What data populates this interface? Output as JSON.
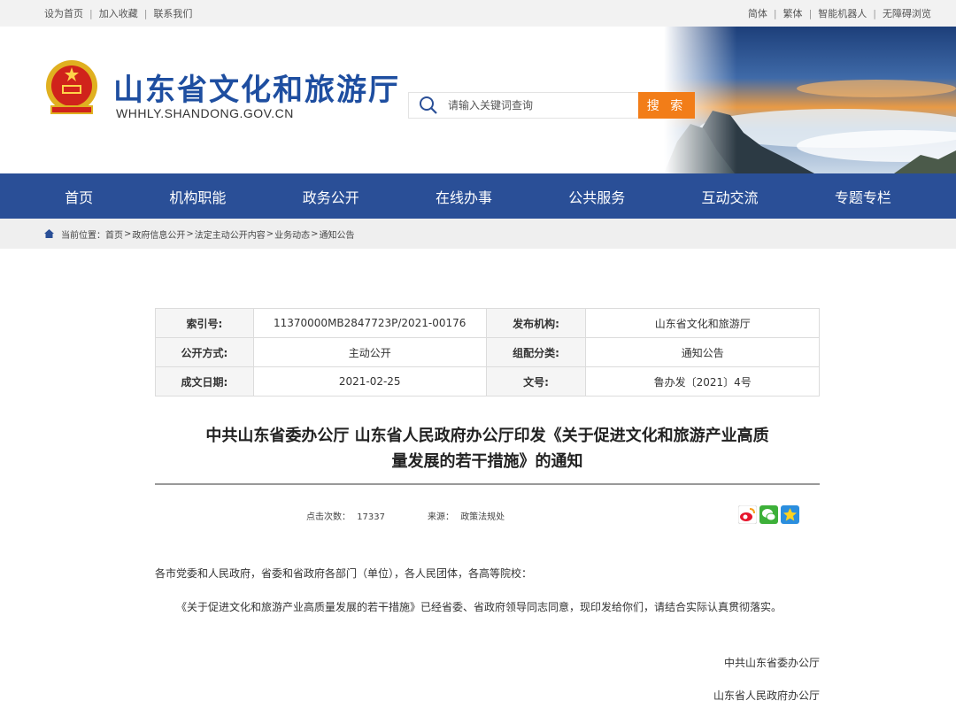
{
  "topbar": {
    "left": [
      "设为首页",
      "加入收藏",
      "联系我们"
    ],
    "right": [
      "简体",
      "繁体",
      "智能机器人",
      "无障碍浏览"
    ]
  },
  "header": {
    "title": "山东省文化和旅游厅",
    "domain": "WHHLY.SHANDONG.GOV.CN",
    "search_placeholder": "请输入关键词查询",
    "search_button": "搜 索"
  },
  "nav": [
    "首页",
    "机构职能",
    "政务公开",
    "在线办事",
    "公共服务",
    "互动交流",
    "专题专栏"
  ],
  "breadcrumb": {
    "prefix": "当前位置：",
    "items": [
      "首页",
      "政府信息公开",
      "法定主动公开内容",
      "业务动态",
      "通知公告"
    ]
  },
  "meta": {
    "index_label": "索引号:",
    "index_value": "11370000MB2847723P/2021-00176",
    "publisher_label": "发布机构:",
    "publisher_value": "山东省文化和旅游厅",
    "open_label": "公开方式:",
    "open_value": "主动公开",
    "category_label": "组配分类:",
    "category_value": "通知公告",
    "date_label": "成文日期:",
    "date_value": "2021-02-25",
    "docno_label": "文号:",
    "docno_value": "鲁办发〔2021〕4号"
  },
  "article": {
    "title_line1": "中共山东省委办公厅 山东省人民政府办公厅印发《关于促进文化和旅游产业高质",
    "title_line2": "量发展的若干措施》的通知",
    "clicks_label": "点击次数：",
    "clicks_value": "17337",
    "source_label": "来源：",
    "source_value": "政策法规处",
    "salutation": "各市党委和人民政府，省委和省政府各部门（单位），各人民团体，各高等院校：",
    "para1": "《关于促进文化和旅游产业高质量发展的若干措施》已经省委、省政府领导同志同意，现印发给你们，请结合实际认真贯彻落实。",
    "sign1": "中共山东省委办公厅",
    "sign2": "山东省人民政府办公厅"
  },
  "share_icons": [
    "weibo-icon",
    "wechat-icon",
    "qzone-icon"
  ]
}
